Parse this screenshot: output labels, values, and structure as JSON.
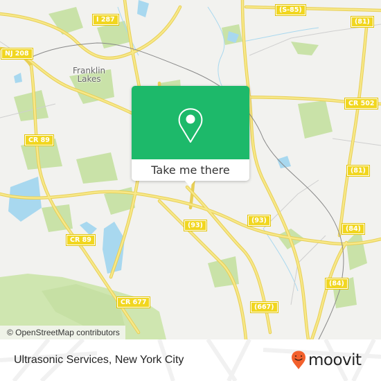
{
  "map": {
    "place_labels": [
      {
        "name": "franklin-lakes",
        "line1": "Franklin",
        "line2": "Lakes"
      }
    ],
    "road_shields": [
      "I 287",
      "NJ 208",
      "(S-85)",
      "(81)",
      "CR 502",
      "CR 89",
      "CR 89",
      "(81)",
      "(93)",
      "(93)",
      "(84)",
      "CR 677",
      "(84)",
      "(667)"
    ],
    "attribution": "© OpenStreetMap contributors",
    "colors": {
      "land": "#f2f2ef",
      "park": "#c9e2a8",
      "water": "#a8d8ef",
      "road": "#f3de6a",
      "rail": "#777777"
    }
  },
  "popup": {
    "icon": "map-pin-icon",
    "action_label": "Take me there",
    "color": "#1db96a"
  },
  "footer": {
    "title": "Ultrasonic Services, New York City",
    "brand": {
      "icon": "moovit-smile-pin-icon",
      "name": "moovit",
      "color": "#f2602c"
    }
  }
}
